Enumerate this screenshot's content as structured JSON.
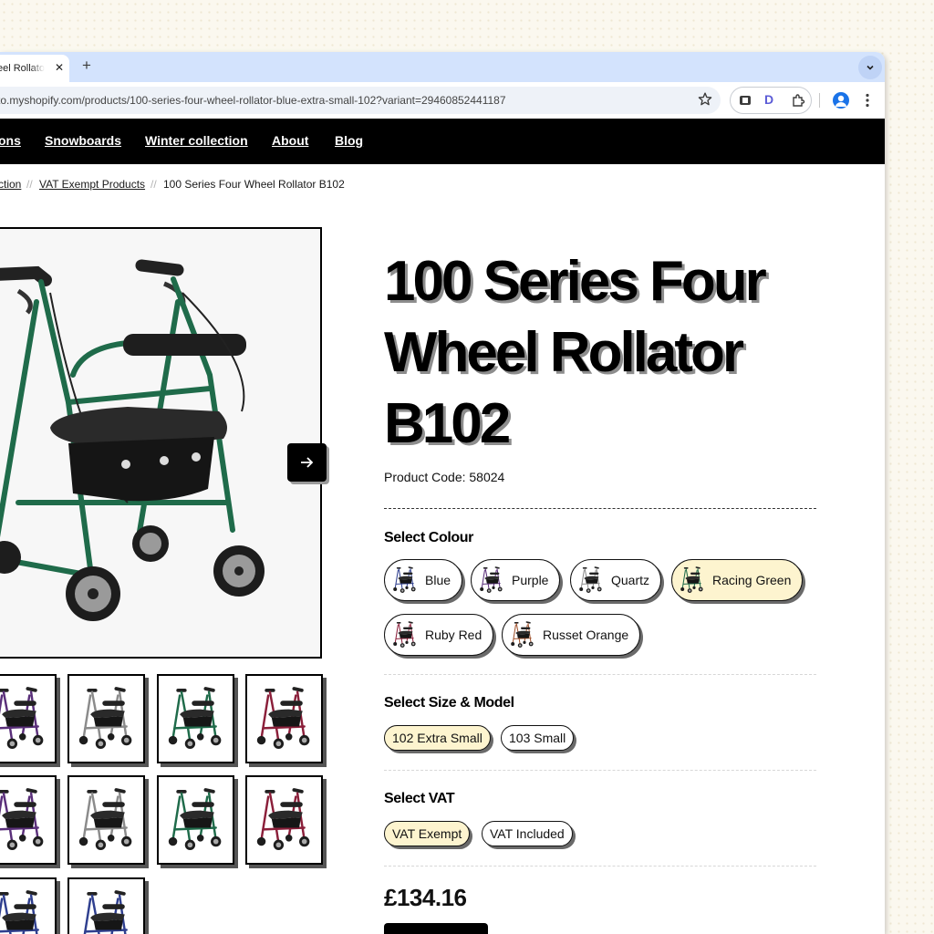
{
  "browser": {
    "tab_title": "eel Rollato",
    "tab_close": "✕",
    "new_tab": "+",
    "url": "to.myshopify.com/products/100-series-four-wheel-rollator-blue-extra-small-102?variant=29460852441187",
    "extension_letter": "D"
  },
  "nav": {
    "items": [
      "ons",
      "Snowboards",
      "Winter collection",
      "About",
      "Blog"
    ]
  },
  "breadcrumb": {
    "first": "ction",
    "second": "VAT Exempt Products",
    "separator": "//",
    "current": "100 Series Four Wheel Rollator B102"
  },
  "product": {
    "title": "100 Series Four Wheel Rollator B102",
    "code": "Product Code: 58024",
    "price": "£134.16",
    "frame_color": "#1f6b4a"
  },
  "colour": {
    "label": "Select Colour",
    "options": [
      "Blue",
      "Purple",
      "Quartz",
      "Racing Green",
      "Ruby Red",
      "Russet Orange"
    ],
    "selected": "Racing Green",
    "option_colors": [
      "#2f3f8f",
      "#5a2f7a",
      "#8b8b8b",
      "#1f6b4a",
      "#8b1f3a",
      "#a0522d"
    ]
  },
  "size": {
    "label": "Select Size & Model",
    "options": [
      "102 Extra Small",
      "103 Small"
    ],
    "selected": "102 Extra Small"
  },
  "vat": {
    "label": "Select VAT",
    "options": [
      "VAT Exempt",
      "VAT Included"
    ],
    "selected": "VAT Exempt"
  },
  "thumbnails": {
    "colors": [
      "#5a2f7a",
      "#8b8b8b",
      "#1f6b4a",
      "#8b1f3a",
      "#5a2f7a",
      "#8b8b8b",
      "#1f6b4a",
      "#8b1f3a",
      "#2f3f8f",
      "#2f3f8f"
    ]
  },
  "accent": {
    "selected_bg": "#fdf4cf",
    "nav_bg": "#000000"
  }
}
